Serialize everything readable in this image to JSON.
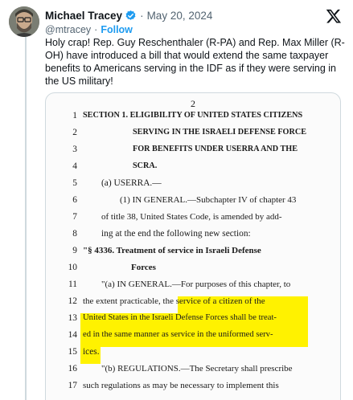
{
  "tweet": {
    "author_name": "Michael Tracey",
    "date": "May 20, 2024",
    "dot": "·",
    "handle": "@mtracey",
    "follow_label": "Follow",
    "text": "Holy crap! Rep. Guy Reschenthaler (R-PA) and Rep. Max Miller (R-OH) have introduced a bill that would extend the same taxpayer benefits to Americans serving in the IDF as if they were serving in the US military!"
  },
  "document": {
    "page_number": "2",
    "lines": [
      {
        "n": "1",
        "t": "SECTION 1. ELIGIBILITY OF UNITED STATES CITIZENS"
      },
      {
        "n": "2",
        "t": "SERVING IN THE ISRAELI DEFENSE FORCE"
      },
      {
        "n": "3",
        "t": "FOR BENEFITS UNDER USERRA AND THE"
      },
      {
        "n": "4",
        "t": "SCRA."
      },
      {
        "n": "5",
        "t": "(a) USERRA.—"
      },
      {
        "n": "6",
        "t": "(1) IN GENERAL.—Subchapter IV of chapter 43"
      },
      {
        "n": "7",
        "t": "of title 38, United States Code, is amended by add-"
      },
      {
        "n": "8",
        "t": "ing at the end the following new section:"
      },
      {
        "n": "9",
        "t": "\"§ 4336. Treatment of service in Israeli Defense"
      },
      {
        "n": "10",
        "t": "Forces"
      },
      {
        "n": "11",
        "t": "\"(a) IN GENERAL.—For purposes of this chapter, to"
      },
      {
        "n": "12",
        "t": "the extent practicable, the service of a citizen of the"
      },
      {
        "n": "13",
        "t": "United States in the Israeli Defense Forces shall be treat-"
      },
      {
        "n": "14",
        "t": "ed in the same manner as service in the uniformed serv-"
      },
      {
        "n": "15",
        "t": "ices."
      },
      {
        "n": "16",
        "t": "\"(b) REGULATIONS.—The Secretary shall prescribe"
      },
      {
        "n": "17",
        "t": "such regulations as may be necessary to implement this"
      }
    ]
  },
  "colors": {
    "highlight": "#fff200",
    "link": "#1d9bf0",
    "verified": "#1d9bf0"
  },
  "icons": [
    "avatar",
    "verified-badge-icon",
    "x-logo-icon"
  ]
}
